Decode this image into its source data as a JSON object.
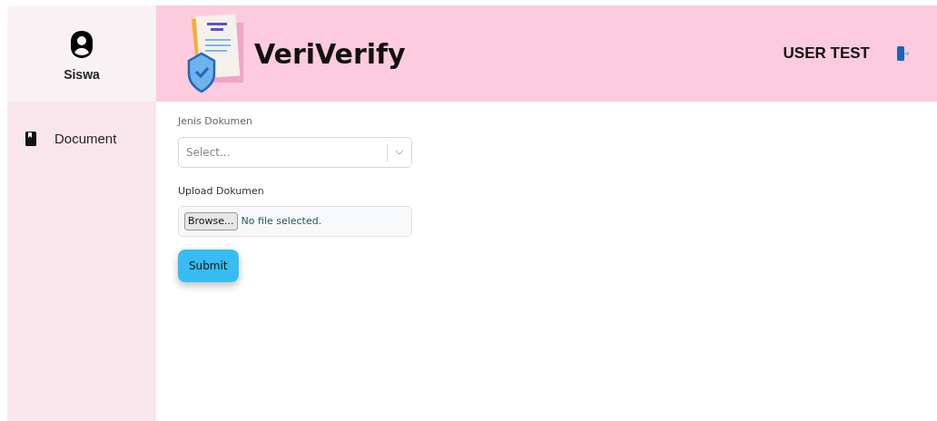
{
  "sidebar": {
    "user_label": "Siswa",
    "items": [
      {
        "label": "Document",
        "selected": false
      }
    ]
  },
  "header": {
    "brand": "VeriVerify",
    "user_name": "USER TEST"
  },
  "form": {
    "fields": [
      {
        "kind": "select",
        "label": "Jenis Dokumen",
        "placeholder": "Select..."
      },
      {
        "kind": "file",
        "label": "Upload Dokumen",
        "button": "Browse...",
        "status": "No file selected."
      }
    ],
    "submit": "Submit"
  }
}
